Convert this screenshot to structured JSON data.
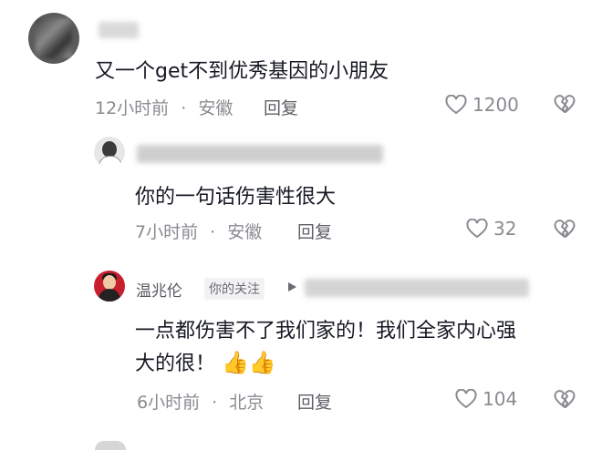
{
  "comments": [
    {
      "text": "又一个get不到优秀基因的小朋友",
      "time": "12小时前",
      "location": "安徽",
      "reply_label": "回复",
      "likes": "1200"
    },
    {
      "text": "你的一句话伤害性很大",
      "time": "7小时前",
      "location": "安徽",
      "reply_label": "回复",
      "likes": "32"
    },
    {
      "author": "温兆伦",
      "tag": "你的关注",
      "text_line1": "一点都伤害不了我们家的！我们全家内心强",
      "text_line2": "大的很！",
      "emojis": "👍👍",
      "time": "6小时前",
      "location": "北京",
      "reply_label": "回复",
      "likes": "104"
    }
  ],
  "separator": "·",
  "icons": {
    "like": "heart-outline-icon",
    "dislike": "broken-heart-icon",
    "arrow": "play-arrow-icon"
  },
  "colors": {
    "text": "#161823",
    "meta": "#8a8b91",
    "thumb": "#f5a623"
  }
}
